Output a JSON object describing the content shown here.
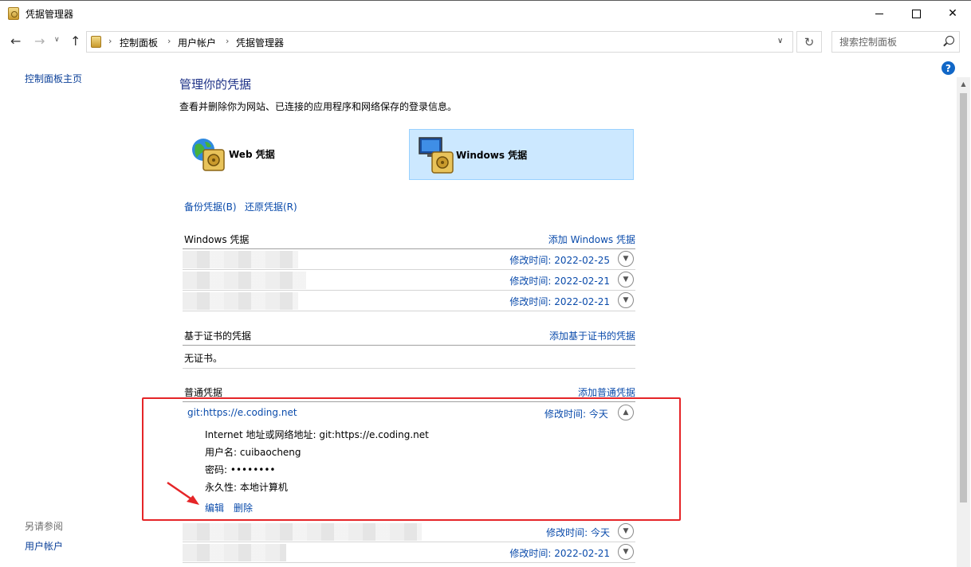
{
  "window": {
    "title": "凭据管理器"
  },
  "address": {
    "crumbs": [
      "控制面板",
      "用户帐户",
      "凭据管理器"
    ],
    "search_placeholder": "搜索控制面板"
  },
  "leftnav": {
    "home": "控制面板主页",
    "see_also": "另请参阅",
    "user_accounts": "用户帐户"
  },
  "main": {
    "title": "管理你的凭据",
    "description": "查看并删除你为网站、已连接的应用程序和网络保存的登录信息。",
    "tiles": {
      "web": "Web 凭据",
      "windows": "Windows 凭据",
      "selected": "windows"
    },
    "backup": "备份凭据(B)",
    "restore": "还原凭据(R)"
  },
  "windows_section": {
    "title": "Windows 凭据",
    "add": "添加 Windows 凭据",
    "rows": [
      {
        "date": "修改时间:  2022-02-25"
      },
      {
        "date": "修改时间:  2022-02-21"
      },
      {
        "date": "修改时间:  2022-02-21"
      }
    ]
  },
  "cert_section": {
    "title": "基于证书的凭据",
    "add": "添加基于证书的凭据",
    "empty": "无证书。"
  },
  "generic_section": {
    "title": "普通凭据",
    "add": "添加普通凭据",
    "expanded": {
      "name": "git:https://e.coding.net",
      "date": "修改时间:  今天",
      "address_label": "Internet 地址或网络地址:",
      "address_value": "git:https://e.coding.net",
      "user_label": "用户名:",
      "user_value": "cuibaocheng",
      "password_label": "密码:",
      "password_value": "••••••••",
      "persistence_label": "永久性:",
      "persistence_value": "本地计算机",
      "edit": "编辑",
      "delete": "删除"
    },
    "rows": [
      {
        "date": "修改时间:  今天"
      },
      {
        "date": "修改时间:  2022-02-21"
      }
    ]
  },
  "colors": {
    "link": "#0a4bab",
    "title": "#1e3287",
    "highlight": "#e52528",
    "selected_tile": "#cce8ff"
  }
}
